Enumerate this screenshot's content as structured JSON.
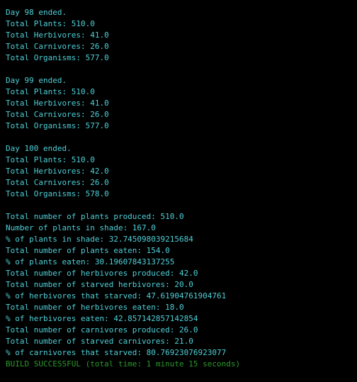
{
  "colors": {
    "background": "#000000",
    "output_text": "#4fd0d8",
    "build_text": "#2c9a2c"
  },
  "days": [
    {
      "ended": "Day 98 ended.",
      "plants": "Total Plants: 510.0",
      "herbivores": "Total Herbivores: 41.0",
      "carnivores": "Total Carnivores: 26.0",
      "organisms": "Total Organisms: 577.0"
    },
    {
      "ended": "Day 99 ended.",
      "plants": "Total Plants: 510.0",
      "herbivores": "Total Herbivores: 41.0",
      "carnivores": "Total Carnivores: 26.0",
      "organisms": "Total Organisms: 577.0"
    },
    {
      "ended": "Day 100 ended.",
      "plants": "Total Plants: 510.0",
      "herbivores": "Total Herbivores: 42.0",
      "carnivores": "Total Carnivores: 26.0",
      "organisms": "Total Organisms: 578.0"
    }
  ],
  "summary": [
    "Total number of plants produced: 510.0",
    "Number of plants in shade: 167.0",
    "% of plants in shade: 32.745098039215684",
    "Total number of plants eaten: 154.0",
    "% of plants eaten: 30.19607843137255",
    "Total number of herbivores produced: 42.0",
    "Total number of starved herbivores: 20.0",
    "% of herbivores that starved: 47.61904761904761",
    "Total number of herbivores eaten: 18.0",
    "% of herbivores eaten: 42.857142857142854",
    "Total number of carnivores produced: 26.0",
    "Total number of starved carnivores: 21.0",
    "% of carnivores that starved: 80.76923076923077"
  ],
  "build_status": "BUILD SUCCESSFUL (total time: 1 minute 15 seconds)"
}
